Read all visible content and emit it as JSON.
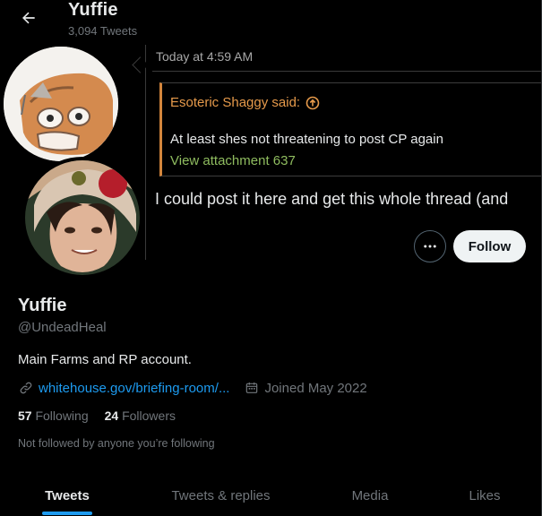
{
  "header": {
    "back_icon": "arrow-left-icon",
    "name": "Yuffie",
    "tweet_count": "3,094 Tweets"
  },
  "banner": {
    "post_time": "Today at 4:59 AM",
    "quote_author": "Esoteric Shaggy said:",
    "quote_author_icon": "arrow-up-circle-icon",
    "quote_text": "At least shes not threatening to post CP again",
    "quote_attachment": "View attachment 637",
    "post_body": "I could post it here and get this whole thread (and",
    "quote_accent_color": "#d3853c"
  },
  "actions": {
    "more_icon": "more-horizontal-icon",
    "follow_label": "Follow"
  },
  "profile": {
    "name": "Yuffie",
    "handle": "@UndeadHeal",
    "bio": "Main Farms and RP account.",
    "link_icon": "link-icon",
    "link_text": "whitehouse.gov/briefing-room/...",
    "joined_icon": "calendar-icon",
    "joined_text": "Joined May 2022",
    "following_count": "57",
    "following_label": "Following",
    "followers_count": "24",
    "followers_label": "Followers",
    "not_followed_text": "Not followed by anyone you’re following"
  },
  "tabs": [
    {
      "label": "Tweets",
      "active": true
    },
    {
      "label": "Tweets & replies",
      "active": false
    },
    {
      "label": "Media",
      "active": false
    },
    {
      "label": "Likes",
      "active": false
    }
  ],
  "colors": {
    "background": "#000000",
    "accent": "#1d9bf0",
    "text_primary": "#e7e9ea",
    "text_secondary": "#71767b"
  }
}
